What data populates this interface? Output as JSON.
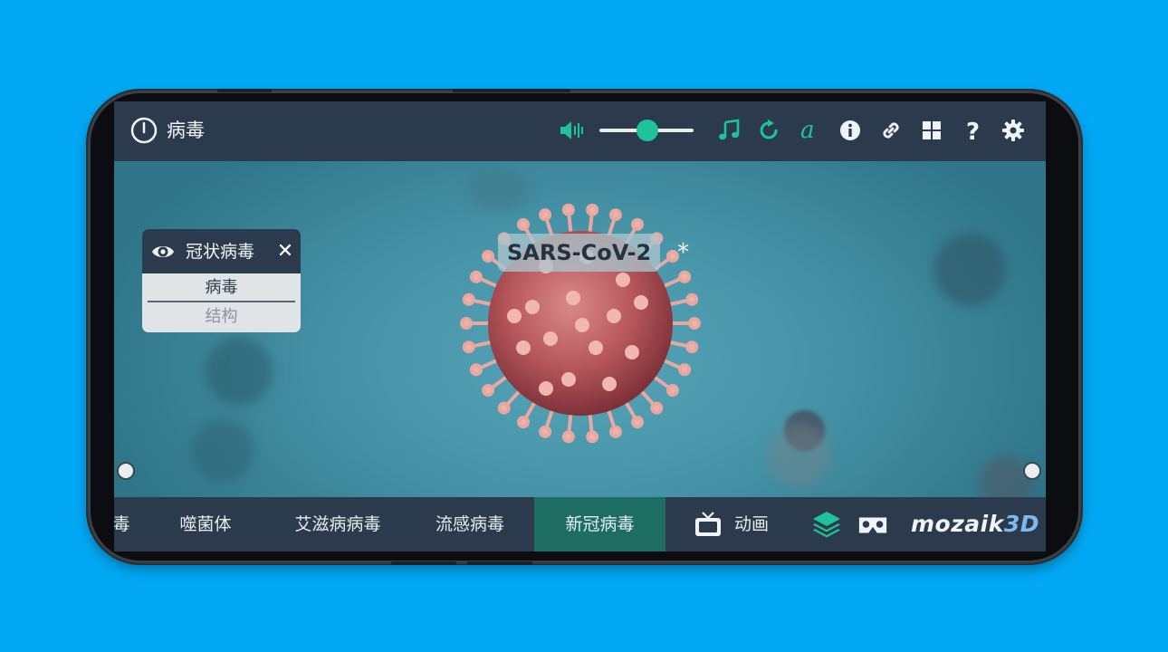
{
  "app": {
    "title": "病毒",
    "brand_main": "mozaik",
    "brand_accent": "3D"
  },
  "toolbar": {
    "icons": [
      "volume-icon",
      "music-icon",
      "reset-icon",
      "text-font-icon",
      "info-icon",
      "link-icon",
      "grid-icon",
      "help-icon",
      "settings-icon"
    ],
    "volume_level": 0.5,
    "accent_color": "#20c29b"
  },
  "scene": {
    "label": "SARS-CoV-2",
    "asterisk": "*"
  },
  "popup": {
    "title": "冠状病毒",
    "items": [
      {
        "label": "病毒",
        "active": true
      },
      {
        "label": "结构",
        "active": false
      }
    ]
  },
  "bottom_tabs": [
    {
      "label": "毒"
    },
    {
      "label": "噬菌体"
    },
    {
      "label": "艾滋病病毒"
    },
    {
      "label": "流感病毒"
    },
    {
      "label": "新冠病毒",
      "active": true
    }
  ],
  "animation_label": "动画",
  "colors": {
    "background": "#02a8f4",
    "bar": "#2b3b4d",
    "active_tab": "#1d6d63"
  }
}
